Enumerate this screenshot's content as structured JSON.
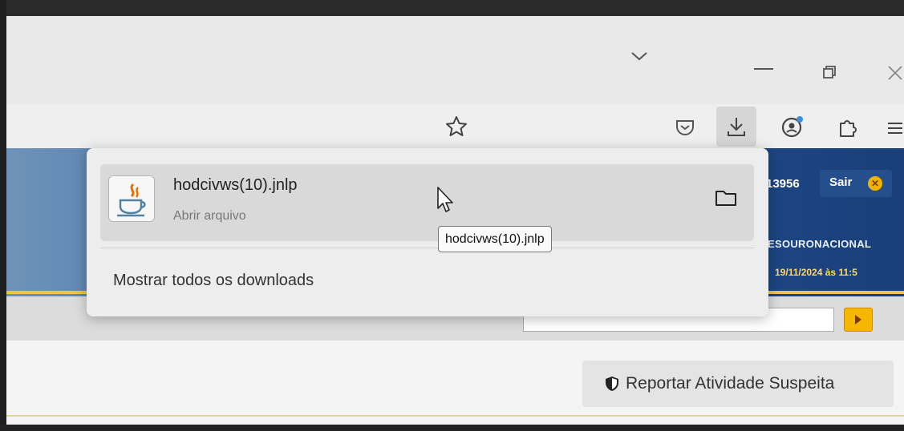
{
  "window": {
    "controls": {
      "minimize": "—",
      "maximize": "▢",
      "close": "✕"
    }
  },
  "toolbar": {
    "icons": [
      "star-icon",
      "pocket-icon",
      "download-icon",
      "account-icon",
      "extensions-icon",
      "menu-icon"
    ]
  },
  "downloads": {
    "item": {
      "filename": "hodcivws(10).jnlp",
      "status": "Abrir arquivo"
    },
    "show_all_label": "Mostrar todos os downloads",
    "tooltip": "hodcivws(10).jnlp"
  },
  "site": {
    "user_id": "13956",
    "logout_label": "Sair",
    "org_name": "ESOURONACIONAL",
    "datetime": "19/11/2024 às 11:5",
    "report_button": "Reportar Atividade Suspeita"
  },
  "colors": {
    "accent": "#f6b700",
    "header": "#1f4d8d",
    "header_text_highlight": "#ffd86a"
  }
}
